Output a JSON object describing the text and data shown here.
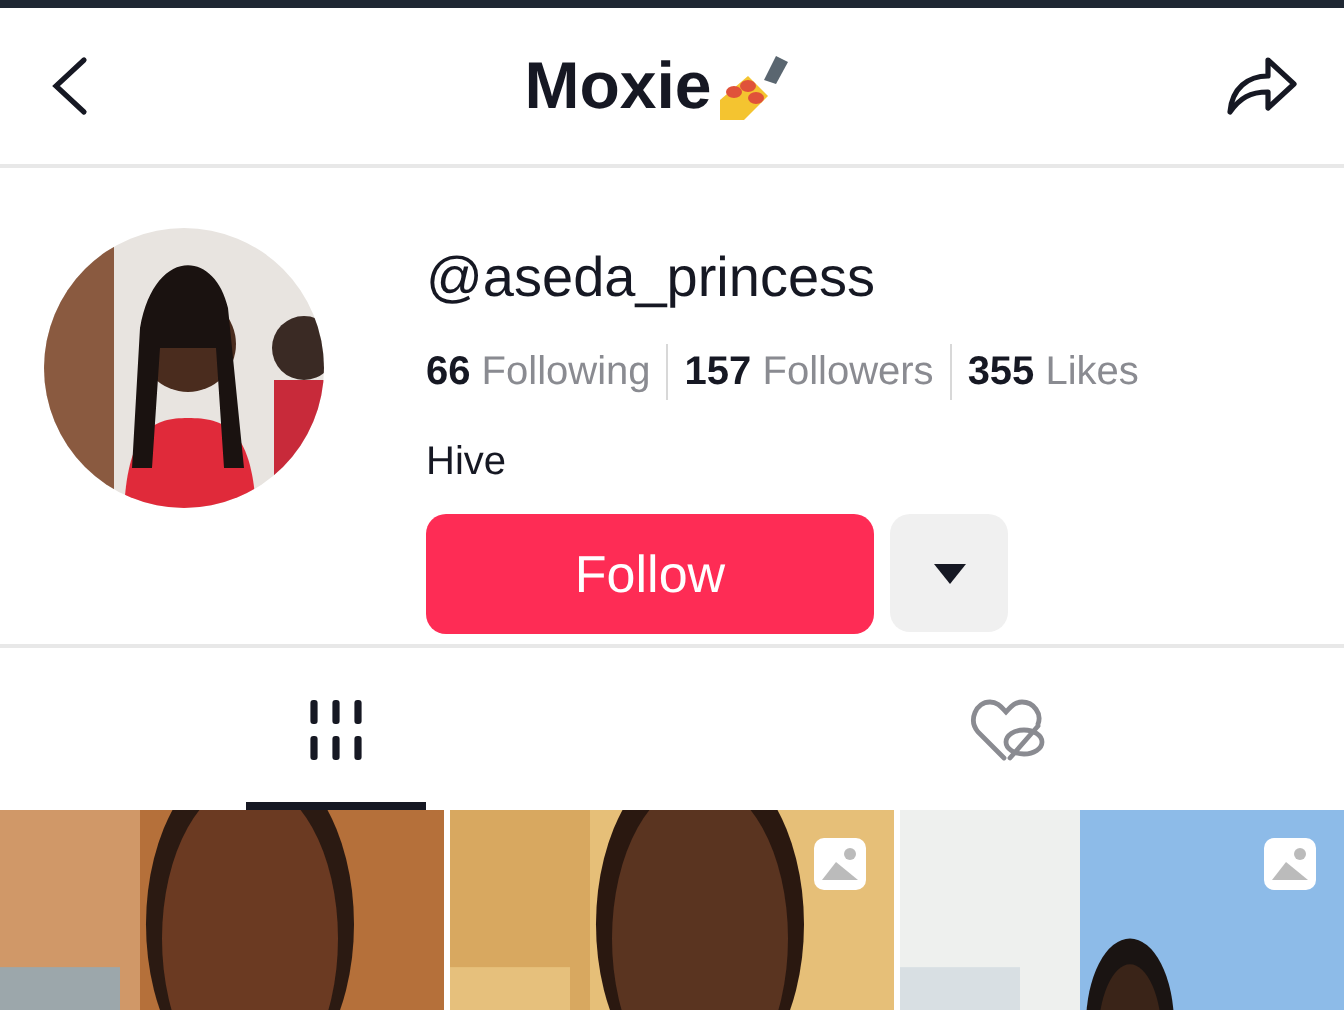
{
  "header": {
    "title": "Moxie"
  },
  "profile": {
    "handle": "@aseda_princess",
    "stats": [
      "**66** Following",
      "**157** Followers",
      "**355** Likes"
    ],
    "bio": "Hive",
    "follow_button": "Follow"
  },
  "tabs": [
    {
      "kind": "videos",
      "selected": true
    },
    {
      "kind": "liked",
      "selected": false
    }
  ],
  "tiles": [
    {
      "kind": "picture",
      "photo_badge": false
    },
    {
      "kind": "picture",
      "photo_badge": true
    },
    {
      "kind": "picture",
      "photo_badge": true
    }
  ]
}
